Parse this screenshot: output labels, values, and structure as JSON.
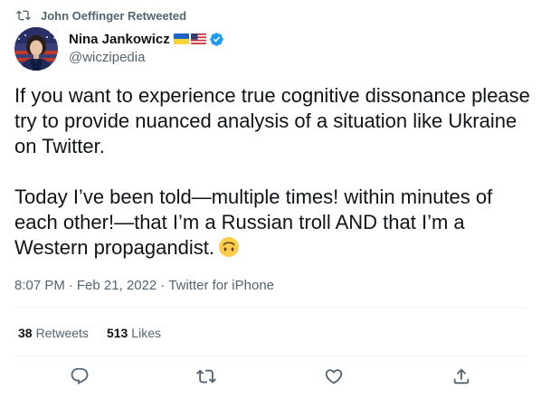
{
  "social_context": {
    "text": "John Oeffinger Retweeted",
    "icon": "retweet-icon"
  },
  "author": {
    "name": "Nina Jankowicz",
    "handle": "@wiczipedia",
    "flags": [
      "ukraine-flag-icon",
      "us-flag-icon"
    ],
    "verified": true,
    "verified_color": "#1d9bf0"
  },
  "tweet": {
    "paragraph1": "If you want to experience true cognitive dissonance please try to provide nuanced analysis of a situation like Ukraine on Twitter.",
    "paragraph2": "Today I’ve been told—multiple times! within minutes of each other!—that I’m a Russian troll AND that I’m a Western propagandist.",
    "emoji": "upside-down-face-emoji"
  },
  "meta": {
    "time": "8:07 PM",
    "separator": "·",
    "date": "Feb 21, 2022",
    "source": "Twitter for iPhone"
  },
  "stats": {
    "retweets_count": "38",
    "retweets_label": "Retweets",
    "likes_count": "513",
    "likes_label": "Likes"
  },
  "actions": [
    "reply-icon",
    "retweet-icon",
    "like-icon",
    "share-icon"
  ],
  "colors": {
    "text": "#0f1419",
    "secondary": "#536471",
    "divider": "#eff3f4",
    "accent": "#1d9bf0"
  }
}
